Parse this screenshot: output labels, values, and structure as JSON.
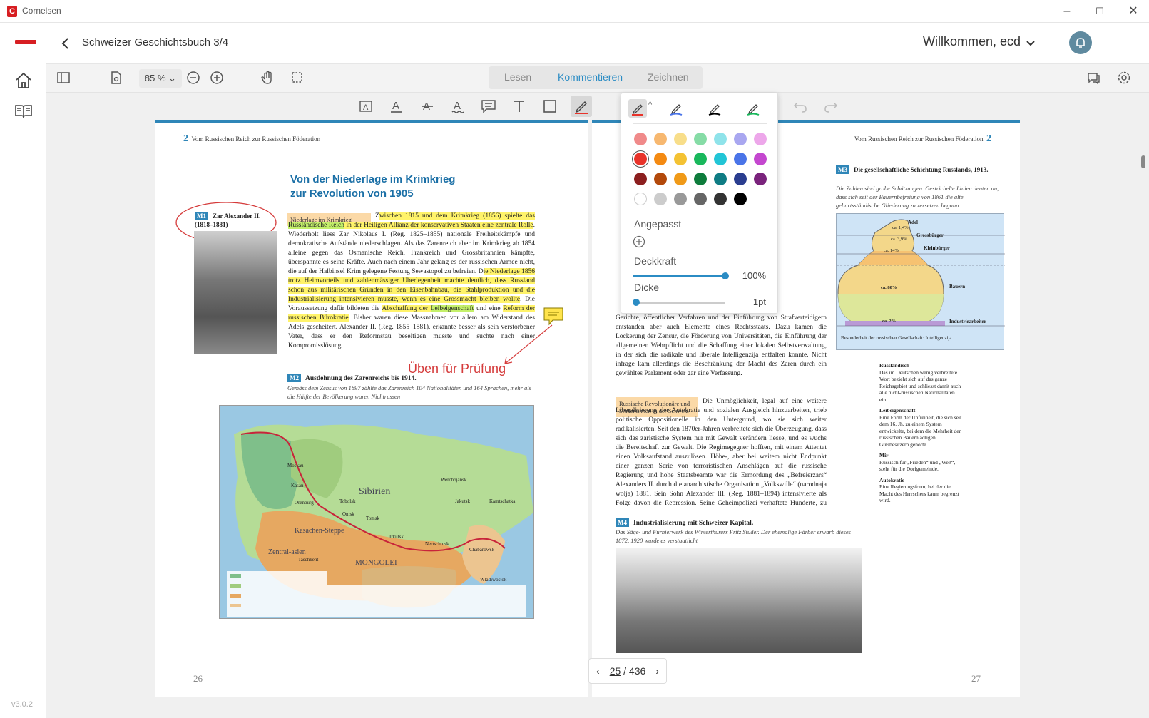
{
  "window": {
    "app_name": "Cornelsen",
    "logo_letter": "C",
    "version": "v3.0.2"
  },
  "header": {
    "book_title": "Schweizer Geschichtsbuch 3/4",
    "welcome": "Willkommen, ecd"
  },
  "toolbar": {
    "zoom": "85 %",
    "tabs": [
      "Lesen",
      "Kommentieren",
      "Zeichnen"
    ],
    "active_tab": "Kommentieren"
  },
  "pen_popup": {
    "custom_label": "Angepasst",
    "opacity_label": "Deckkraft",
    "opacity_value": "100%",
    "opacity": 1.0,
    "thickness_label": "Dicke",
    "thickness_value": "1pt",
    "thickness": 0.0,
    "colors": [
      [
        "#f08a8a",
        "#f7b870",
        "#f8de8a",
        "#86dca6",
        "#8fe3ea",
        "#a9a7f0",
        "#eda7ea"
      ],
      [
        "#e8332a",
        "#f48a12",
        "#f4c233",
        "#19b85c",
        "#22c5d6",
        "#4a74e8",
        "#c447cf"
      ],
      [
        "#8c1f1f",
        "#b3490b",
        "#f09a18",
        "#0e7c3c",
        "#0f7c84",
        "#2a3d8f",
        "#7a237c"
      ],
      [
        "#ffffff",
        "#cccccc",
        "#999999",
        "#666666",
        "#333333",
        "#000000",
        ""
      ]
    ],
    "selected_color": "#e8332a"
  },
  "left_page": {
    "running_head_num": "2",
    "running_head": "Vom Russischen Reich zur Russischen Föderation",
    "title_1": "Von der Niederlage im Krimkrieg",
    "title_2": "zur Revolution von 1905",
    "m1_badge": "M1",
    "m1_caption": "Zar Alexander II. (1818–1881)",
    "sidebox": "Niederlage im Krimkrieg",
    "text_pre": "Z",
    "text_hl1": "wischen 1815 und dem Krimkrieg (1856) spielte das",
    "text_hl2": "Russländische Reich",
    "text_hl3": " in der Heiligen Allianz der konservativen Staaten eine zentrale Rolle",
    "text_2": ". Wiederholt liess Zar Nikolaus I. (Reg. 1825–1855) nationale Freiheitskämpfe und demokratische Aufstände niederschlagen. Als das Zarenreich aber im Krimkrieg ab 1854 alleine gegen das Osmanische Reich, Frankreich und Grossbritannien kämpfte, überspannte es seine Kräfte. Auch nach einem Jahr gelang es der russischen Armee nicht, die auf der Halbinsel Krim gelegene Festung Sewastopol zu befreien. D",
    "text_hl4": "ie Niederlage 1856 trotz Heimvorteils und zahlenmässiger Überlegenheit machte deutlich, dass Russland schon aus militärischen Gründen in den Eisenbahnbau, die Stahlproduktion und die Industrialisierung intensivieren musste, wenn es eine Grossmacht bleiben wollte",
    "text_3": ". Die Voraussetzung dafür bildeten die ",
    "text_hl5": "Abschaffung der ",
    "text_hl6": "Leibeigenschaft",
    "text_4": " und eine ",
    "text_hl7": "Reform der russischen Bürokratie",
    "text_5": ". Bisher waren diese Massnahmen vor allem am Widerstand des Adels gescheitert. Alexander II. (Reg. 1855–1881), erkannte besser als sein verstorbener Vater, dass er den Reformstau beseitigen musste und suchte nach einer Kompromisslösung.",
    "annotation": "Üben für Prüfung",
    "m2_badge": "M2",
    "m2_caption": "Ausdehnung des Zarenreichs bis 1914.",
    "m2_sub": "Gemäss dem Zensus von 1897 zählte das Zarenreich 104 Nationalitäten und 164 Sprachen, mehr als die Hälfte der Bevölkerung waren Nichtrussen",
    "map_labels": [
      "Sibirien",
      "Kasachen-Steppe",
      "Zentral-asien",
      "MONGOLEI",
      "Moskau",
      "Kasan",
      "Omsk",
      "Tomsk",
      "Jakutsk",
      "Werchojansk",
      "Kamtschatka",
      "Wladiwostok",
      "Nertschinsk",
      "Chabarowsk",
      "Irkutsk",
      "Tobolsk",
      "Orenburg",
      "Taschkent"
    ],
    "page_number": "26"
  },
  "right_page": {
    "running_head_num": "2",
    "running_head": "Vom Russischen Reich zur Russischen Föderation",
    "m3_badge": "M3",
    "m3_caption": "Die gesellschaftliche Schichtung Russlands, 1913.",
    "m3_sub": "Die Zahlen sind grobe Schätzungen. Gestrichelte Linien deuten an, dass sich seit der Bauernbefreiung von 1861 die alte geburtsständische Gliederung zu zersetzen begann",
    "pyramid": {
      "layers": [
        "Adel",
        "Grossbürger",
        "Kleinbürger",
        "Bauern",
        "Industriearbeiter"
      ],
      "shares": [
        "ca. 1,4%",
        "ca. 3,9%",
        "ca. 14%",
        "ca. 80%",
        "ca. 2%"
      ],
      "footnote": "Besonderheit der russischen Gesellschaft: Intelligenzija"
    },
    "col_text": "Gerichte, öffentlicher Verfahren und der Einführung von Strafverteidigern entstanden aber auch Elemente eines Rechtsstaats. Dazu kamen die Lockerung der Zensur, die Förderung von Universitäten, die Einführung der allgemeinen Wehrpflicht und die Schaffung einer lokalen Selbstverwaltung, in der sich die radikale und liberale Intelligenzija entfalten konnte. Nicht infrage kam allerdings die Beschränkung der Macht des Zaren durch ein gewähltes Parlament oder gar eine Verfassung.",
    "sidebox": "Russische Revolutionäre und Studentinnen in der Schweiz",
    "col_text_2": "Die Unmöglichkeit, legal auf eine weitere Liberalisierung der Autokratie und sozialen Ausgleich hinzuarbeiten, trieb politische Oppositionelle in den Untergrund, wo sie sich weiter radikalisierten. Seit den 1870er-Jahren verbreitete sich die Überzeugung, dass sich das zaristische System nur mit Gewalt verändern liesse, und es wuchs die Bereitschaft zur Gewalt. Die Regimegegner hofften, mit einem Attentat einen Volksaufstand auszulösen. Höhe-, aber bei weitem nicht Endpunkt einer ganzen Serie von terroristischen Anschlägen auf die russische Regierung und hohe Staatsbeamte war die Ermordung des „Befreierzars“ Alexanders II. durch die anarchistische Organisation „Volkswille“ (narodnaja wolja) 1881. Sein Sohn Alexander III. (Reg. 1881–1894) intensivierte als Folge davon die Repression. Seine Geheimpolizei verhaftete Hunderte, zu Recht oder zu Unrecht, und deportierte sie nach Sibirien. Als Folge",
    "m4_badge": "M4",
    "m4_caption": "Industrialisierung mit Schweizer Kapital.",
    "m4_sub": "Das Säge- und Furnierwerk des Winterthurers Fritz Studer. Der ehemalige Färber erwarb dieses 1872, 1920 wurde es verstaatlicht",
    "glossary": [
      {
        "term": "Russländisch",
        "def": "Das im Deutschen wenig verbreitete Wort bezieht sich auf das ganze Reichsgebiet und schliesst damit auch alle nicht-russischen Nationalitäten ein."
      },
      {
        "term": "Leibeigenschaft",
        "def": "Eine Form der Unfreiheit, die sich seit dem 16. Jh. zu einem System entwickelte, bei dem die Mehrheit der russischen Bauern adligen Gutsbesitzern gehörte."
      },
      {
        "term": "Mir",
        "def": "Russisch für „Frieden“ und „Welt“, steht für die Dorfgemeinde."
      },
      {
        "term": "Autokratie",
        "def": "Eine Regierungsform, bei der die Macht des Herrschers kaum begrenzt wird."
      }
    ],
    "page_number": "27"
  },
  "page_nav": {
    "current": "25",
    "total": "/ 436"
  }
}
